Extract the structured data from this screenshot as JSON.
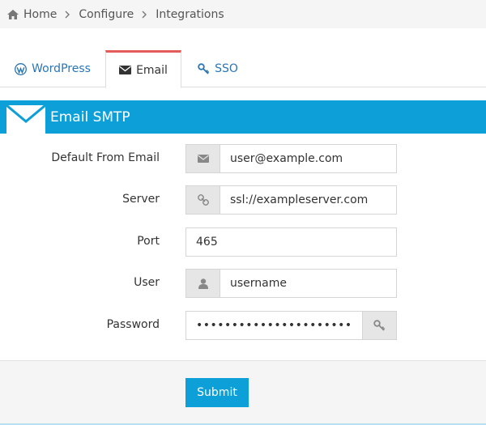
{
  "breadcrumb": {
    "items": [
      "Home",
      "Configure",
      "Integrations"
    ]
  },
  "tabs": [
    {
      "label": "WordPress",
      "icon": "wordpress-icon",
      "active": false
    },
    {
      "label": "Email",
      "icon": "envelope-icon",
      "active": true
    },
    {
      "label": "SSO",
      "icon": "key-icon",
      "active": false
    }
  ],
  "section": {
    "title": "Email SMTP",
    "icon": "envelope-icon",
    "color": "#0d9fd8"
  },
  "form": {
    "default_from_email": {
      "label": "Default From Email",
      "value": "user@example.com",
      "icon": "envelope-icon"
    },
    "server": {
      "label": "Server",
      "value": "ssl://exampleserver.com",
      "icon": "link-icon"
    },
    "port": {
      "label": "Port",
      "value": "465"
    },
    "user": {
      "label": "User",
      "value": "username",
      "icon": "user-icon"
    },
    "password": {
      "label": "Password",
      "value": "••••••••••••••••••••••",
      "icon": "key-icon"
    }
  },
  "actions": {
    "submit_label": "Submit"
  },
  "colors": {
    "accent": "#0d9fd8",
    "active_tab_top": "#e35b5b",
    "link": "#2a76b5"
  }
}
